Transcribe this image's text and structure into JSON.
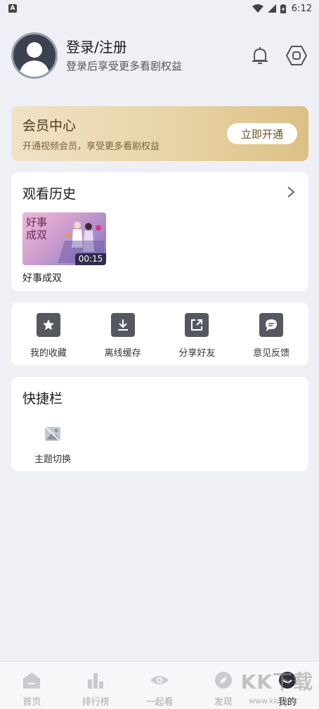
{
  "status_bar": {
    "notification_letter": "A",
    "time": "6:12"
  },
  "profile": {
    "title": "登录/注册",
    "subtitle": "登录后享受更多看剧权益"
  },
  "vip": {
    "title": "会员中心",
    "subtitle": "开通视频会员，享受更多看剧权益",
    "button_label": "立即开通"
  },
  "history": {
    "title": "观看历史",
    "items": [
      {
        "name": "好事成双",
        "duration": "00:15",
        "thumb_text": "好事成双"
      }
    ]
  },
  "shortcuts": [
    {
      "label": "我的收藏",
      "icon": "star-icon"
    },
    {
      "label": "离线缓存",
      "icon": "download-icon"
    },
    {
      "label": "分享好友",
      "icon": "share-icon"
    },
    {
      "label": "意见反馈",
      "icon": "feedback-icon"
    }
  ],
  "quick_bar": {
    "title": "快捷栏",
    "items": [
      {
        "label": "主题切换",
        "icon": "theme-icon"
      }
    ]
  },
  "bottom_nav": [
    {
      "label": "首页",
      "icon": "home-icon"
    },
    {
      "label": "排行榜",
      "icon": "chart-icon"
    },
    {
      "label": "一起看",
      "icon": "eye-icon"
    },
    {
      "label": "发现",
      "icon": "compass-icon"
    },
    {
      "label": "我的",
      "icon": "profile-icon",
      "active": true
    }
  ],
  "watermark": {
    "text": "KK下载",
    "url": "www.kkx.net"
  },
  "colors": {
    "background": "#eef0f5",
    "vip_gold_start": "#efe2c6",
    "vip_gold_end": "#dcc085",
    "icon_gray": "#55585f"
  }
}
